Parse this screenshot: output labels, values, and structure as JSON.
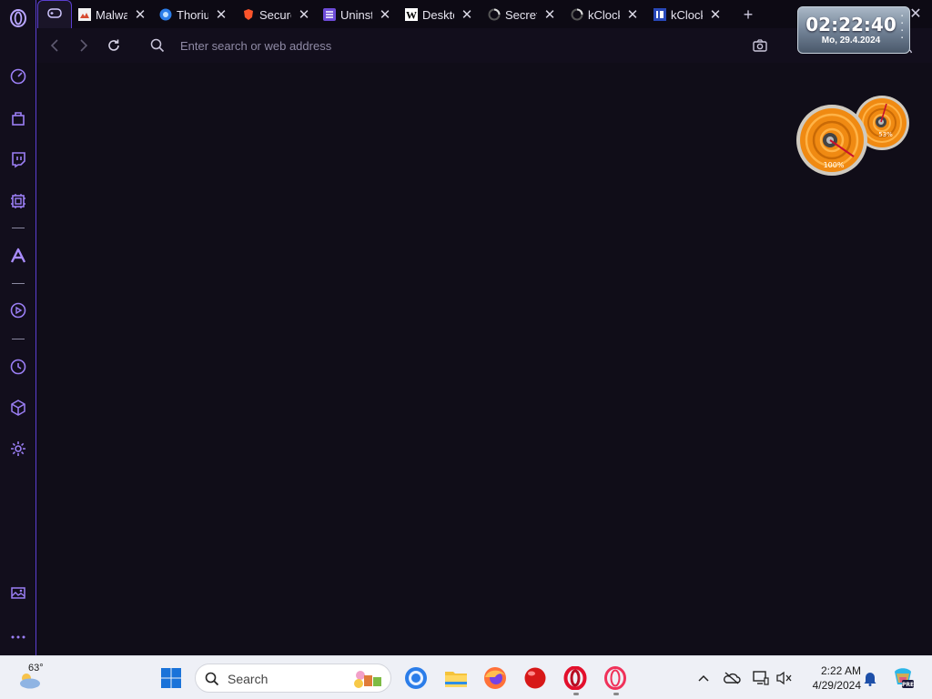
{
  "tabs": [
    {
      "label": "Malwa",
      "icon": "malwarebytes-icon"
    },
    {
      "label": "Thoriu",
      "icon": "thorium-icon"
    },
    {
      "label": "Secure",
      "icon": "brave-icon"
    },
    {
      "label": "Uninst",
      "icon": "uninstall-list-icon"
    },
    {
      "label": "Deskto",
      "icon": "wikipedia-icon"
    },
    {
      "label": "Secret",
      "icon": "loading-spinner-icon"
    },
    {
      "label": "kClock",
      "icon": "loading-spinner-icon"
    },
    {
      "label": "kClock",
      "icon": "kclock-page-icon"
    }
  ],
  "address": {
    "placeholder": "Enter search or web address"
  },
  "clock_widget": {
    "time": "02:22:40",
    "date": "Mo, 29.4.2024"
  },
  "gauges": [
    {
      "name": "cpu-gauge",
      "value_label": "100%",
      "value": 100
    },
    {
      "name": "ram-gauge",
      "value_label": "53%",
      "value": 53
    }
  ],
  "taskbar": {
    "weather_temp": "63°",
    "search_label": "Search",
    "time": "2:22 AM",
    "date": "4/29/2024"
  },
  "colors": {
    "accent": "#5b3fd0",
    "sidebar_icon": "#9b7ff5",
    "background": "#100d18",
    "taskbar": "#eef0f6"
  }
}
